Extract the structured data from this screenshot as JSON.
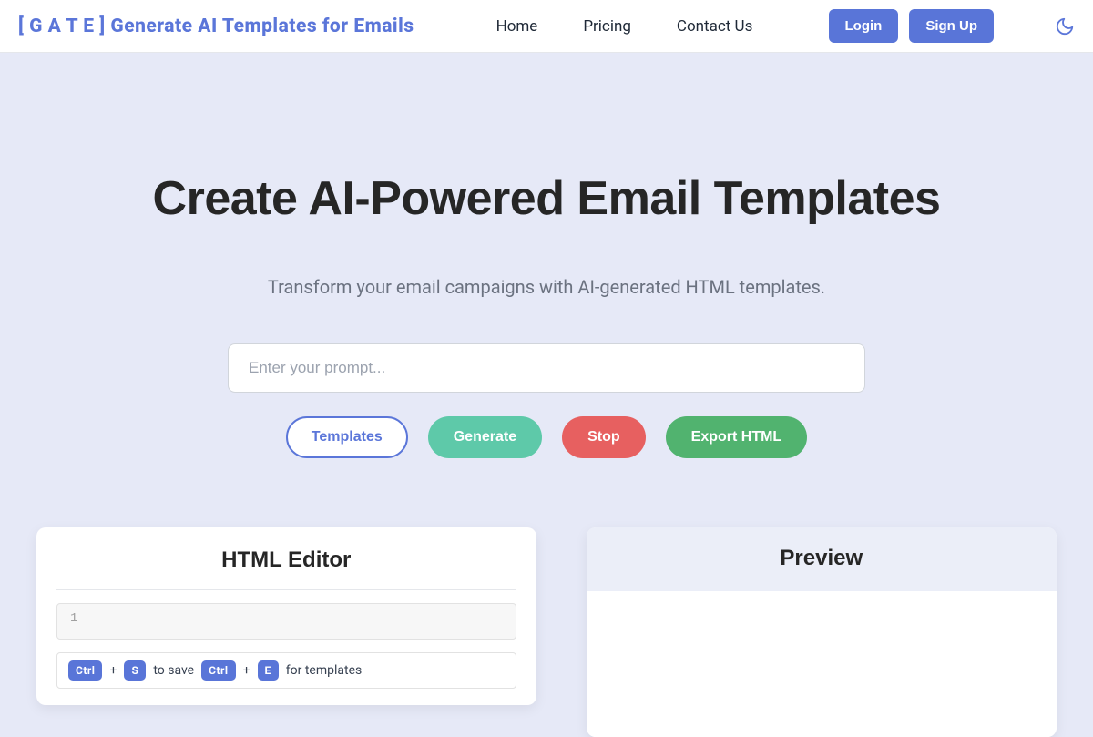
{
  "brand": "[ G A T E ] Generate AI Templates for Emails",
  "nav": {
    "home": "Home",
    "pricing": "Pricing",
    "contact": "Contact Us"
  },
  "auth": {
    "login": "Login",
    "signup": "Sign Up"
  },
  "hero": {
    "title": "Create AI-Powered Email Templates",
    "subtitle": "Transform your email campaigns with AI-generated HTML templates."
  },
  "prompt": {
    "placeholder": "Enter your prompt..."
  },
  "actions": {
    "templates": "Templates",
    "generate": "Generate",
    "stop": "Stop",
    "export": "Export HTML"
  },
  "editor": {
    "title": "HTML Editor",
    "first_line_number": "1",
    "hint": {
      "ctrl": "Ctrl",
      "s_key": "S",
      "e_key": "E",
      "plus": "+",
      "to_save": "to save",
      "for_templates": "for templates"
    }
  },
  "preview": {
    "title": "Preview"
  }
}
